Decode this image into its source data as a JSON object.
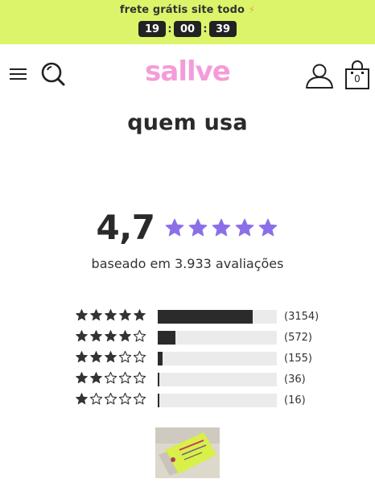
{
  "promo": {
    "text": "frete grátis site todo",
    "bolt": "⚡",
    "countdown": [
      "19",
      "00",
      "39"
    ],
    "separator": ":"
  },
  "header": {
    "logo": "sallve",
    "logo_color": "#f49cd9",
    "menu_icon": "hamburger-menu-icon",
    "search_icon": "search-icon",
    "account_icon": "user-icon",
    "bag_icon": "shopping-bag-icon",
    "bag_count": "0"
  },
  "section": {
    "title": "quem usa"
  },
  "rating": {
    "value": "4,7",
    "stars": 5,
    "star_color": "#8b6fe8",
    "caption": "baseado em 3.933 avaliações"
  },
  "distribution": [
    {
      "stars": 5,
      "count_label": "(3154)",
      "fraction": 0.8
    },
    {
      "stars": 4,
      "count_label": "(572)",
      "fraction": 0.15
    },
    {
      "stars": 3,
      "count_label": "(155)",
      "fraction": 0.04
    },
    {
      "stars": 2,
      "count_label": "(36)",
      "fraction": 0.01
    },
    {
      "stars": 1,
      "count_label": "(16)",
      "fraction": 0.004
    }
  ],
  "colors": {
    "promo_bg": "#dcf46a",
    "bar_fill": "#2b2b2b",
    "bar_track": "#ebebeb",
    "star_dark": "#333333"
  }
}
